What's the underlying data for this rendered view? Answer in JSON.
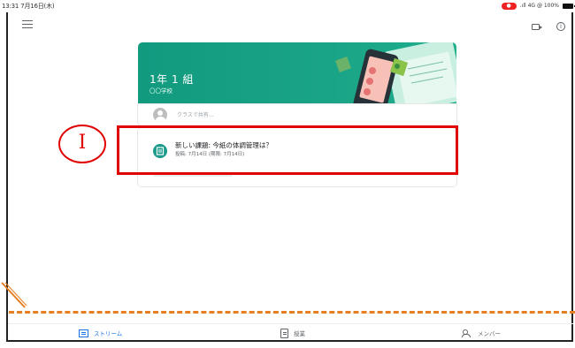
{
  "status_bar": {
    "time_date": "13:31  7月16日(木)",
    "right_text": ".ıll 4G @ 100%"
  },
  "class": {
    "name": "1年 1 組",
    "school": "〇〇学校"
  },
  "post_box": {
    "placeholder": "クラスで共有..."
  },
  "assignment": {
    "title": "新しい課題: 今紙の体調管理は？",
    "meta": "投稿: 7月14日 (期限: 7月14日)"
  },
  "annotation": {
    "marker_label": "I",
    "highlight_color": "#e10000",
    "dash_color": "#e67e22"
  },
  "bottom_nav": {
    "stream": "ストリーム",
    "classwork": "授業",
    "people": "メンバー"
  },
  "colors": {
    "banner": "#16a085",
    "accent": "#1a73e8"
  },
  "icons": [
    "menu-icon",
    "video-icon",
    "info-icon",
    "avatar",
    "assignment-icon",
    "stream-icon",
    "classwork-icon",
    "people-icon"
  ]
}
